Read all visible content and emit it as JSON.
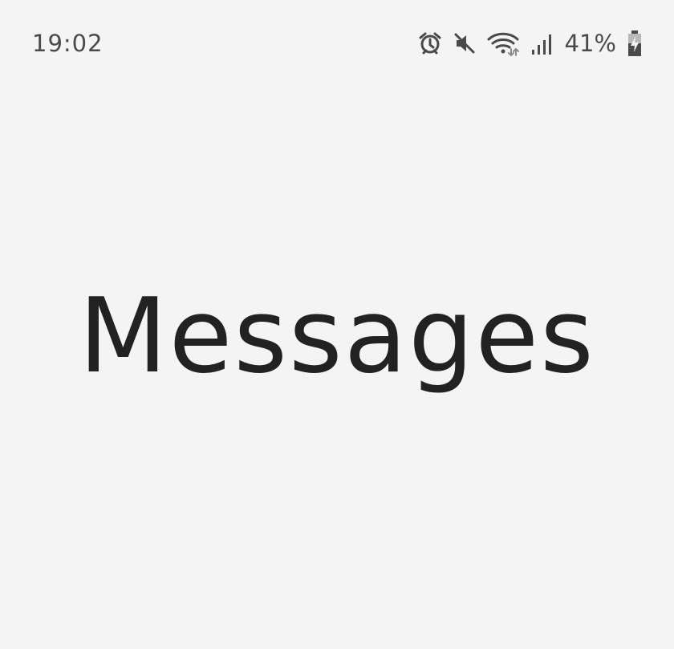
{
  "status_bar": {
    "time": "19:02",
    "battery_percent": "41%",
    "icons": [
      "alarm-icon",
      "mute-icon",
      "wifi-icon",
      "signal-icon",
      "battery-charging-icon"
    ]
  },
  "main": {
    "title": "Messages"
  },
  "colors": {
    "background": "#f4f4f4",
    "text": "#222222",
    "status_text": "#4a4a4a"
  }
}
